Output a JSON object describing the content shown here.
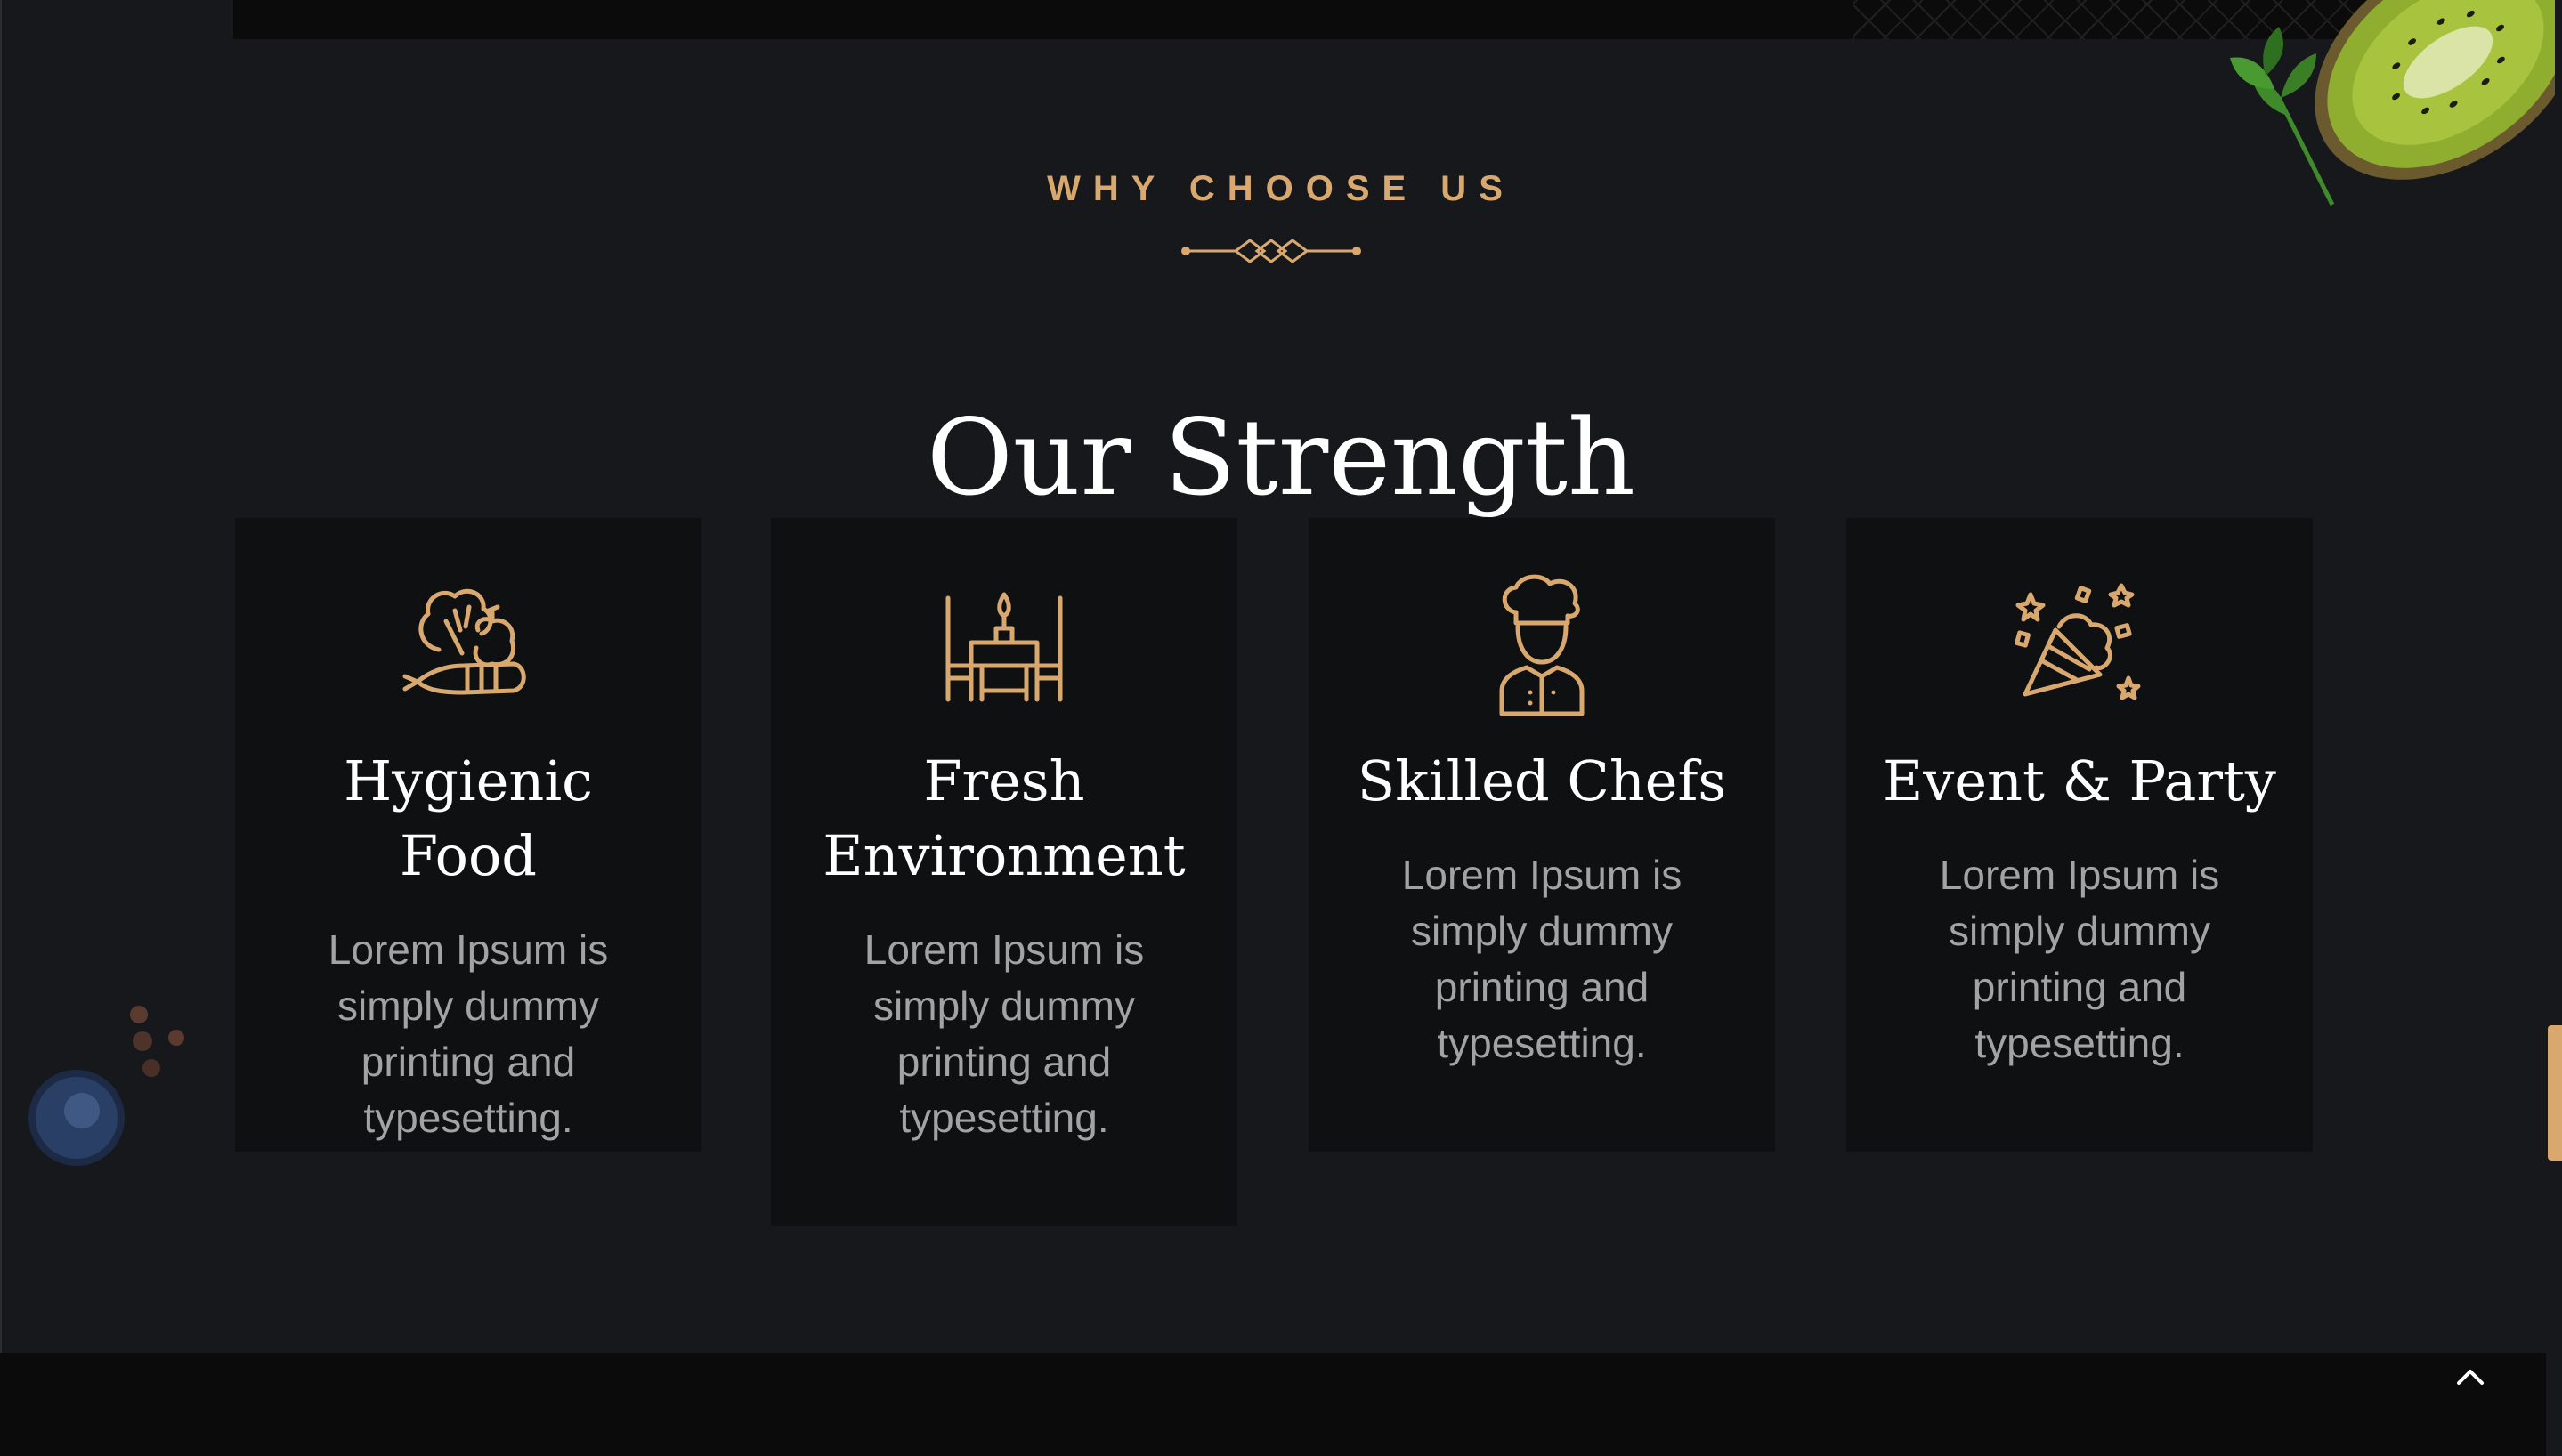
{
  "section": {
    "eyebrow": "WHY CHOOSE US",
    "title": "Our Strength"
  },
  "features": [
    {
      "icon": "vegetables-icon",
      "title": "Hygienic Food",
      "text": "Lorem Ipsum is simply dummy printing and typesetting."
    },
    {
      "icon": "dining-table-icon",
      "title": "Fresh Environment",
      "text": "Lorem Ipsum is simply dummy printing and typesetting."
    },
    {
      "icon": "chef-icon",
      "title": "Skilled Chefs",
      "text": "Lorem Ipsum is simply dummy printing and typesetting."
    },
    {
      "icon": "party-popper-icon",
      "title": "Event & Party",
      "text": "Lorem Ipsum is simply dummy printing and typesetting."
    }
  ],
  "scroll_top": {
    "icon": "chevron-up-icon"
  },
  "colors": {
    "background": "#16181c",
    "card": "#0f1012",
    "accent_gold": "#d9a86e",
    "heading": "#ffffff",
    "body_text": "#a3a3a5"
  }
}
